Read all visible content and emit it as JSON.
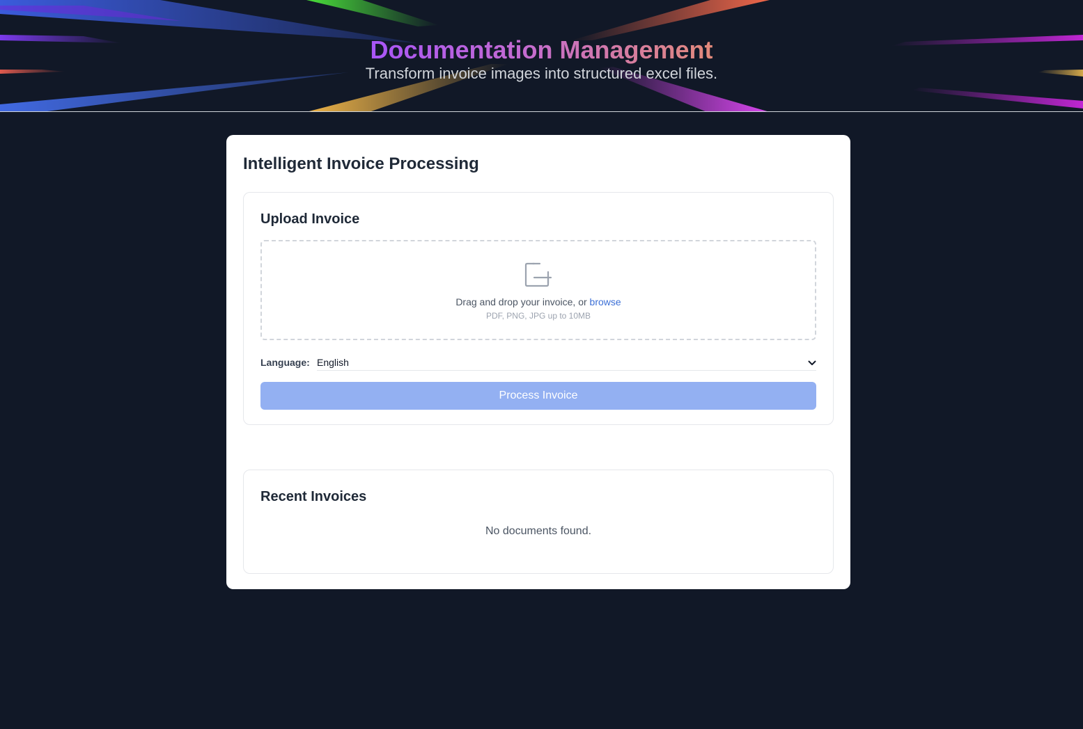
{
  "header": {
    "title": "Documentation Management",
    "subtitle": "Transform invoice images into structured excel files."
  },
  "main": {
    "title": "Intelligent Invoice Processing",
    "upload": {
      "title": "Upload Invoice",
      "icon": "file-plus-icon",
      "drop_text": "Drag and drop your invoice, or ",
      "browse_label": "browse",
      "hint": "PDF, PNG, JPG up to 10MB",
      "language_label": "Language:",
      "language_value": "English",
      "process_button": "Process Invoice"
    },
    "recent": {
      "title": "Recent Invoices",
      "empty_text": "No documents found."
    }
  },
  "colors": {
    "background": "#111827",
    "card": "#ffffff",
    "accent_link": "#3b6fd6",
    "button_disabled": "#93b0f2",
    "title_gradient_start": "#a855f7",
    "title_gradient_end": "#e38a7a"
  }
}
